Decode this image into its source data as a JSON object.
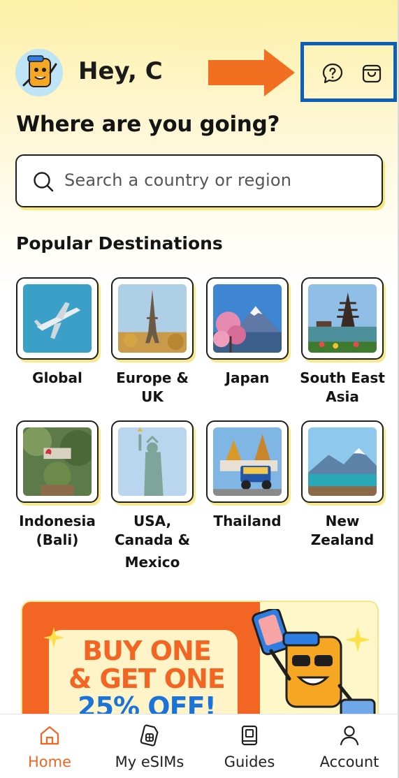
{
  "header": {
    "greeting": "Hey, C",
    "help_icon": "help-chat-icon",
    "cart_icon": "shopping-bag-icon"
  },
  "title": "Where are you going?",
  "search": {
    "placeholder": "Search a country or region",
    "icon": "search-icon"
  },
  "popular": {
    "title": "Popular Destinations",
    "items": [
      {
        "label_lines": [
          "Global"
        ]
      },
      {
        "label_lines": [
          "Europe &",
          "UK"
        ]
      },
      {
        "label_lines": [
          "Japan"
        ]
      },
      {
        "label_lines": [
          "South East",
          "Asia"
        ]
      },
      {
        "label_lines": [
          "Indonesia",
          "(Bali)"
        ]
      },
      {
        "label_lines": [
          "USA,",
          "Canada &",
          "Mexico"
        ]
      },
      {
        "label_lines": [
          "Thailand"
        ]
      },
      {
        "label_lines": [
          "New",
          "Zealand"
        ]
      }
    ]
  },
  "promo": {
    "line1": "BUY ONE",
    "line2": "& GET ONE",
    "line3": "25% OFF!"
  },
  "nav": [
    {
      "label": "Home",
      "icon": "home-icon",
      "active": true
    },
    {
      "label": "My eSIMs",
      "icon": "esim-icon",
      "active": false
    },
    {
      "label": "Guides",
      "icon": "guide-book-icon",
      "active": false
    },
    {
      "label": "Account",
      "icon": "account-icon",
      "active": false
    }
  ],
  "colors": {
    "accent": "#f26522",
    "highlight_box": "#0d5fb8",
    "promo_blue": "#1a73d9"
  }
}
